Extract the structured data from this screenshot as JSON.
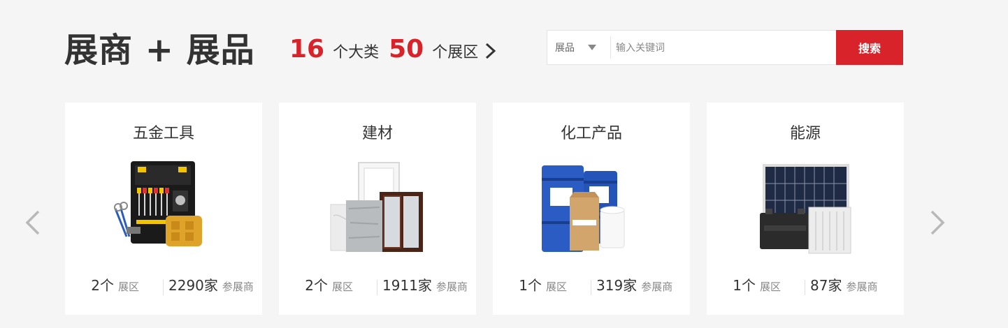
{
  "header": {
    "title": "展商 + 展品",
    "stats": [
      {
        "number": "16",
        "unit": "个大类"
      },
      {
        "number": "50",
        "unit": "个展区"
      }
    ]
  },
  "search": {
    "select_value": "展品",
    "placeholder": "输入关键词",
    "button_label": "搜索"
  },
  "colors": {
    "accent": "#d9232b",
    "background": "#f5f5f5"
  },
  "categories": [
    {
      "title": "五金工具",
      "zones": "2个",
      "zones_label": "展区",
      "exhibitors": "2290家",
      "exhibitors_label": "参展商",
      "icon": "toolbox-icon"
    },
    {
      "title": "建材",
      "zones": "2个",
      "zones_label": "展区",
      "exhibitors": "1911家",
      "exhibitors_label": "参展商",
      "icon": "building-materials-icon"
    },
    {
      "title": "化工产品",
      "zones": "1个",
      "zones_label": "展区",
      "exhibitors": "319家",
      "exhibitors_label": "参展商",
      "icon": "chemical-barrels-icon"
    },
    {
      "title": "能源",
      "zones": "1个",
      "zones_label": "展区",
      "exhibitors": "87家",
      "exhibitors_label": "参展商",
      "icon": "solar-battery-icon"
    }
  ]
}
